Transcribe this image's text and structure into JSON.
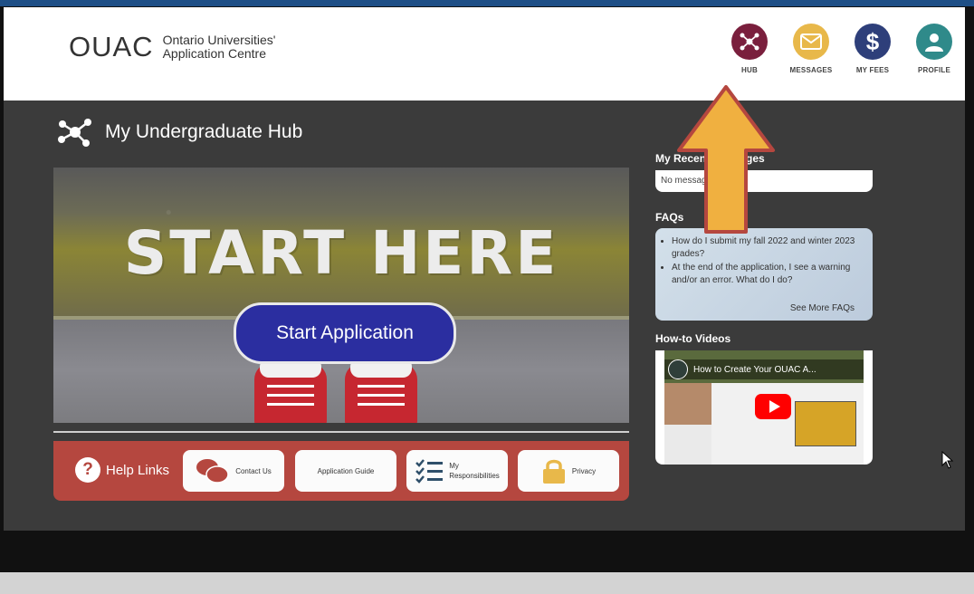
{
  "header": {
    "logo_mark": "OUAC",
    "logo_line1": "Ontario Universities'",
    "logo_line2": "Application Centre",
    "nav": [
      {
        "label": "HUB",
        "icon": "hub-icon",
        "color": "#7a1f3d"
      },
      {
        "label": "MESSAGES",
        "icon": "envelope-icon",
        "color": "#e8b84a"
      },
      {
        "label": "MY FEES",
        "icon": "dollar-icon",
        "color": "#2e3f7a"
      },
      {
        "label": "PROFILE",
        "icon": "profile-icon",
        "color": "#2f8a8a"
      }
    ]
  },
  "main": {
    "title": "My Undergraduate Hub",
    "hero_text": "START HERE",
    "start_button": "Start Application",
    "help": {
      "label": "Help Links",
      "buttons": [
        "Contact Us",
        "Application Guide",
        "My\nResponsibilities",
        "Privacy"
      ]
    }
  },
  "sidebar": {
    "messages_title": "My Recent Messages",
    "messages_empty": "No messages",
    "faq_title": "FAQs",
    "faq_items": [
      "How do I submit my fall 2022 and winter 2023 grades?",
      "At the end of the application, I see a warning and/or an error. What do I do?"
    ],
    "faq_more": "See More FAQs",
    "videos_title": "How-to Videos",
    "video_title": "How to Create Your OUAC A..."
  },
  "colors": {
    "accent_red": "#b5473f",
    "button_blue": "#2b2ea0",
    "arrow_orange": "#f0b040"
  }
}
